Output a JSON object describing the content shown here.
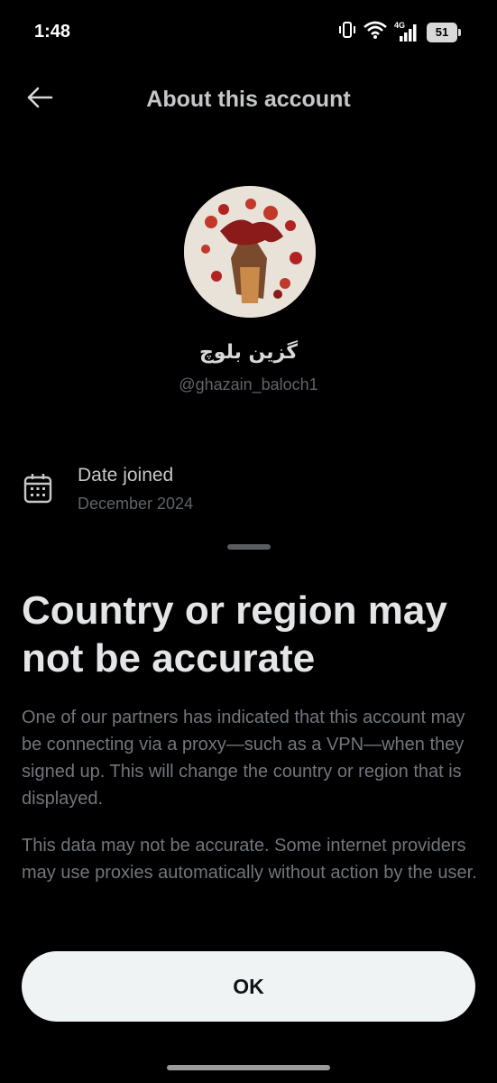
{
  "status_bar": {
    "time": "1:48",
    "network": "4G",
    "battery": "51",
    "icons": [
      "vibrate-icon",
      "wifi-icon",
      "signal-icon",
      "battery-icon"
    ]
  },
  "header": {
    "title": "About this account",
    "back_icon": "arrow-left-icon"
  },
  "profile": {
    "display_name": "گزین بلوچ",
    "handle": "@ghazain_baloch1"
  },
  "date_joined": {
    "icon": "calendar-icon",
    "label": "Date joined",
    "value": "December 2024"
  },
  "sheet": {
    "title": "Country or region may not be accurate",
    "paragraph_1": "One of our partners has indicated that this account may be connecting via a proxy—such as a VPN—when they signed up. This will change the country or region that is displayed.",
    "paragraph_2": "This data may not be accurate. Some internet providers may use proxies automatically without action by the user.",
    "ok_label": "OK"
  },
  "colors": {
    "background": "#000000",
    "primary_text": "#e7e9ea",
    "secondary_text": "#71767b",
    "button_bg": "#eff3f4",
    "button_text": "#0f1419"
  }
}
